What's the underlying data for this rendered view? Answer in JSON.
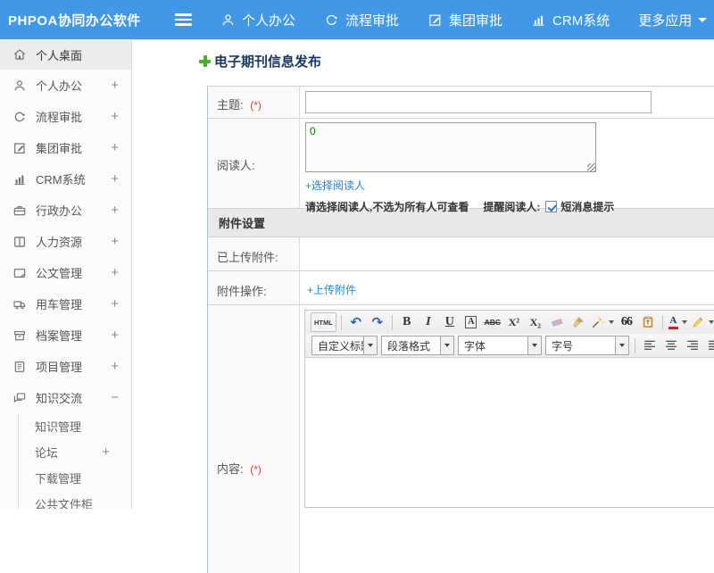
{
  "header": {
    "logo": "PHPOA协同办公软件",
    "nav": [
      {
        "label": "个人办公",
        "icon": "user-icon"
      },
      {
        "label": "流程审批",
        "icon": "flow-icon"
      },
      {
        "label": "集团审批",
        "icon": "edit-icon"
      },
      {
        "label": "CRM系统",
        "icon": "bar-chart-icon"
      },
      {
        "label": "更多应用",
        "icon": "caret-down-icon"
      }
    ]
  },
  "sidebar": {
    "items": [
      {
        "label": "个人桌面",
        "icon": "home-icon",
        "expander": "",
        "selected": true
      },
      {
        "label": "个人办公",
        "icon": "user-icon",
        "expander": "+"
      },
      {
        "label": "流程审批",
        "icon": "flow-icon",
        "expander": "+"
      },
      {
        "label": "集团审批",
        "icon": "edit-icon",
        "expander": "+"
      },
      {
        "label": "CRM系统",
        "icon": "bar-chart-icon",
        "expander": "+"
      },
      {
        "label": "行政办公",
        "icon": "briefcase-icon",
        "expander": "+"
      },
      {
        "label": "人力资源",
        "icon": "book-icon",
        "expander": "+"
      },
      {
        "label": "公文管理",
        "icon": "document-icon",
        "expander": "+"
      },
      {
        "label": "用车管理",
        "icon": "truck-icon",
        "expander": "+"
      },
      {
        "label": "档案管理",
        "icon": "archive-icon",
        "expander": "+"
      },
      {
        "label": "项目管理",
        "icon": "notebook-icon",
        "expander": "+"
      },
      {
        "label": "知识交流",
        "icon": "chat-icon",
        "expander": "−",
        "expanded": true
      }
    ],
    "sub_items": [
      {
        "label": "知识管理",
        "expander": ""
      },
      {
        "label": "论坛",
        "expander": "+"
      },
      {
        "label": "下载管理",
        "expander": ""
      },
      {
        "label": "公共文件柜",
        "expander": ""
      }
    ]
  },
  "main": {
    "page_title": "电子期刊信息发布",
    "form": {
      "subject_label": "主题:",
      "required_mark": "(*)",
      "subject_value": "",
      "readers_label": "阅读人:",
      "readers_value": "0",
      "select_readers_link": "+选择阅读人",
      "readers_note": "请选择阅读人,不选为所有人可查看",
      "remind_readers_label": "提醒阅读人:",
      "sms_tip_label": "短消息提示",
      "sms_checked": true,
      "attachments_section_title": "附件设置",
      "uploaded_attachments_label": "已上传附件:",
      "attachment_actions_label": "附件操作:",
      "upload_attachment_link": "+上传附件",
      "content_label": "内容:"
    },
    "editor": {
      "toolbar": {
        "html": "HTML",
        "undo_icon": "↶",
        "redo_icon": "↷",
        "bold": "B",
        "italic": "I",
        "underline": "U",
        "font_box": "A",
        "strikethrough": "ABC",
        "superscript": "X²",
        "subscript": "X₂",
        "blockquote": "66",
        "forecolor": "A"
      },
      "selects": [
        {
          "label": "自定义标题"
        },
        {
          "label": "段落格式"
        },
        {
          "label": "字体"
        },
        {
          "label": "字号"
        }
      ]
    }
  },
  "colors": {
    "topbar_blue": "#4297e7",
    "link_blue": "#2a80d0",
    "required_red": "#e23b3b",
    "add_green": "#46b22e",
    "title_navy": "#17375e",
    "section_gray": "#e9e9e9",
    "reader_value_green": "#008000"
  }
}
